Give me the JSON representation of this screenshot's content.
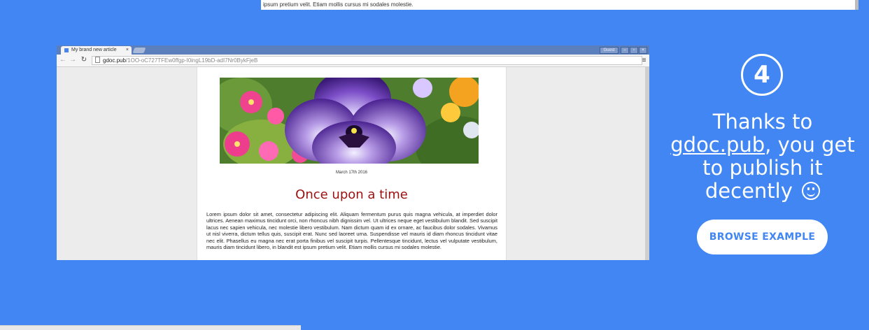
{
  "top_strip": {
    "text": "ipsum pretium velit. Etiam mollis cursus mi sodales molestie."
  },
  "browser": {
    "tab_title": "My brand new article",
    "tab_close": "×",
    "guest_label": "Guest",
    "window_buttons": [
      "–",
      "▫",
      "×"
    ],
    "url_host": "gdoc.pub",
    "url_path": "/1OO-oC727TFEw0ffgp-I0ingL19bD-adI7Nr0BykFjeB",
    "back_icon": "arrow-left",
    "forward_icon": "arrow-right",
    "reload_icon": "reload",
    "menu_icon": "hamburger"
  },
  "article": {
    "date": "March 17th 2016",
    "title": "Once upon a time",
    "body": "Lorem ipsum dolor sit amet, consectetur adipiscing elit. Aliquam fermentum purus quis magna vehicula, at imperdiet dolor ultrices. Aenean maximus tincidunt orci, non rhoncus nibh dignissim vel. Ut ultrices neque eget vestibulum blandit. Sed suscipit lacus nec sapien vehicula, nec molestie libero vestibulum. Nam dictum quam id ex ornare, ac faucibus dolor sodales. Vivamus ut nisl viverra, dictum tellus quis, suscipit erat. Nunc sed laoreet urna. Suspendisse vel mauris id diam rhoncus tincidunt vitae nec elit. Phasellus eu magna nec erat porta finibus vel suscipit turpis. Pellentesque tincidunt, lectus vel vulputate vestibulum, mauris diam tincidunt libero, in blandit est ipsum pretium velit. Etiam mollis cursus mi sodales molestie."
  },
  "promo": {
    "step_number": "4",
    "line_before": "Thanks to",
    "link_text": "gdoc.pub",
    "line_after": ", you get to publish it decently",
    "button_label": "BROWSE EXAMPLE"
  },
  "colors": {
    "background": "#4186f3",
    "title_red": "#9b1010",
    "button_text": "#4186f3"
  }
}
